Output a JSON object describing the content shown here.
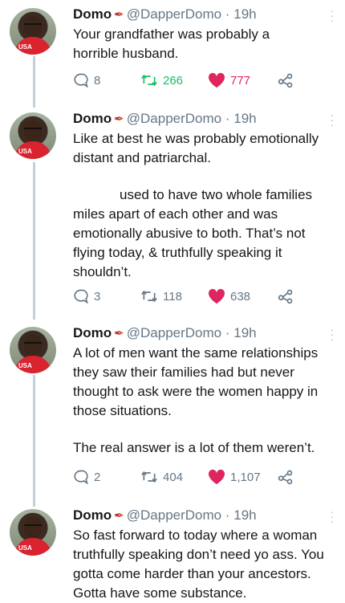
{
  "tweets": [
    {
      "name": "Domo",
      "handle": "@DapperDomo",
      "time": "19h",
      "text_lines": [
        "Your grandfather was probably a horrible husband."
      ],
      "replies": "8",
      "retweets": "266",
      "likes": "777"
    },
    {
      "name": "Domo",
      "handle": "@DapperDomo",
      "time": "19h",
      "text_lines": [
        "Like at best he was probably emotionally distant and patriarchal.",
        "used to have two whole families miles apart of each other and was emotionally abusive to both. That’s not flying today, & truthfully speaking it shouldn’t."
      ],
      "replies": "3",
      "retweets": "118",
      "likes": "638"
    },
    {
      "name": "Domo",
      "handle": "@DapperDomo",
      "time": "19h",
      "text_lines": [
        "A lot of men want the same relationships they saw their families had but never thought to ask were the women happy in those situations.",
        "The real answer is a lot of them weren’t."
      ],
      "replies": "2",
      "retweets": "404",
      "likes": "1,107"
    },
    {
      "name": "Domo",
      "handle": "@DapperDomo",
      "time": "19h",
      "text_lines": [
        "So fast forward to today where a woman truthfully speaking don’t need yo ass. You gotta come harder than your ancestors. Gotta have some substance."
      ]
    }
  ],
  "avatar_badge": "USA",
  "colors": {
    "like": "#e0245e",
    "retweet": "#17bf63",
    "muted": "#657786",
    "thread": "#c4cfd6"
  }
}
